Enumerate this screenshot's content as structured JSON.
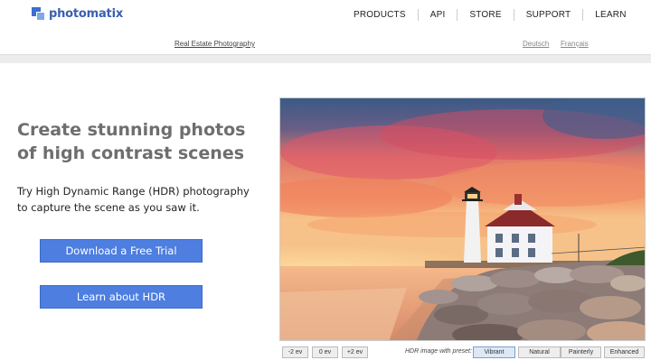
{
  "brand": {
    "name": "photomatix",
    "color": "#3a5fb0"
  },
  "nav": [
    {
      "label": "PRODUCTS"
    },
    {
      "label": "API"
    },
    {
      "label": "STORE"
    },
    {
      "label": "SUPPORT"
    },
    {
      "label": "LEARN"
    }
  ],
  "subbar": {
    "link": "Real Estate Photography",
    "lang_de": "Deutsch",
    "lang_fr": "Français"
  },
  "hero": {
    "headline": "Create stunning photos of high contrast scenes",
    "tagline": "Try High Dynamic Range (HDR) photography to capture the scene as you saw it.",
    "trial_button": "Download a Free Trial",
    "learn_button": "Learn about HDR",
    "accent": "#4d7ee0"
  },
  "viewer": {
    "ev_buttons": [
      "-2 ev",
      "0 ev",
      "+2 ev"
    ],
    "preset_label": "HDR image with preset:",
    "presets": [
      "Vibrant",
      "Natural",
      "Painterly",
      "Enhanced"
    ],
    "active_preset": "Vibrant"
  }
}
